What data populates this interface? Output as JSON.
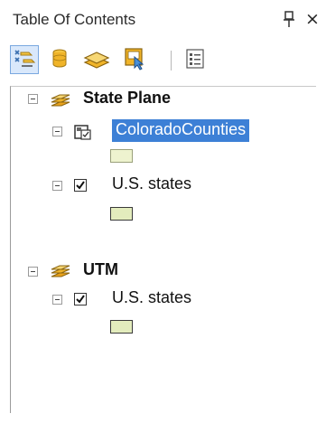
{
  "window": {
    "title": "Table Of Contents",
    "pin_icon": "pin-icon",
    "close_label": "×"
  },
  "toolbar": {
    "buttons": [
      {
        "name": "list-by-drawing-order-button",
        "icon": "drawing-order-icon",
        "active": true
      },
      {
        "name": "list-by-source-button",
        "icon": "source-icon"
      },
      {
        "name": "list-by-visibility-button",
        "icon": "visibility-icon"
      },
      {
        "name": "list-by-selection-button",
        "icon": "selection-icon"
      },
      {
        "name": "options-button",
        "icon": "options-icon"
      }
    ]
  },
  "tree": {
    "data_frames": [
      {
        "name": "State Plane",
        "expanded": true,
        "layers": [
          {
            "name": "ColoradoCounties",
            "checked": false,
            "selected": true,
            "symbol_color": "#eef3cf"
          },
          {
            "name": "U.S. states",
            "checked": true,
            "selected": false,
            "symbol_color": "#e3ecbd"
          }
        ]
      },
      {
        "name": "UTM",
        "expanded": true,
        "layers": [
          {
            "name": "U.S. states",
            "checked": true,
            "selected": false,
            "symbol_color": "#e3ecbd"
          }
        ]
      }
    ]
  },
  "colors": {
    "selection": "#3d80d6",
    "layer_icon": "#f0b429"
  }
}
